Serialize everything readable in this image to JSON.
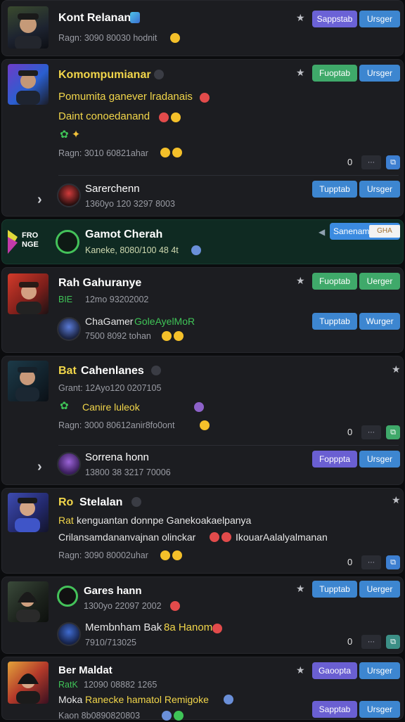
{
  "buttons": {
    "sapptab": "Sappstab",
    "ursger": "Ursger",
    "fuoptab": "Fuoptab",
    "tupptab": "Tupptab",
    "wurger": "Wurger",
    "fopppta": "Fopppta",
    "gaoopta": "Gaoopta",
    "ursger2": "Uerger",
    "sapptab2": "Sapptab"
  },
  "card1": {
    "name": "Kont Relanan",
    "meta": "Ragn: 3090 80030  hodnit"
  },
  "card2": {
    "name": "Komompumianar",
    "line1": "Pomumita ganever lradanais",
    "line2": "Daint conoedanand",
    "meta": "Ragn: 3010 60821ahar",
    "count": "0",
    "sub_name": "Sarerchenn",
    "sub_meta": "1360yo 120 3297 8003"
  },
  "card3": {
    "name": "Gamot Cherah",
    "meta": "Kaneke, 8080/100 48 4t",
    "logo_text": "FRO NGE",
    "badge": "Sanenam",
    "badge2": "GHA"
  },
  "card4": {
    "name": "Rah Gahuranye",
    "meta": "12mo 93202002",
    "meta_prefix": "BIE",
    "sub_name": "ChaGamer",
    "sub_name2": "GoleAyelMoR",
    "sub_meta": "7500 8092 tohan"
  },
  "card5": {
    "name": "Cahenlanes",
    "name_prefix": "Bat",
    "meta": "Grant: 12Ayo120 0207105",
    "line1": "Canire luleok",
    "line2": "Ragn: 3000 80612anir8fo0ont",
    "count": "0",
    "sub_name": "Sorrena honn",
    "sub_meta": "13800 38 3217 70006"
  },
  "card6": {
    "name": "Stelalan",
    "name_prefix": "Ro",
    "line_prefix": "Rat",
    "line1": "kenguantan donnpe Ganekoakaelpanya",
    "line2": "Crilansamdananvajnan olinckar",
    "line2b": "IkouarAalalyalmanan",
    "meta": "Ragn: 3090 80002uhar",
    "count": "0"
  },
  "card7": {
    "name": "Gares hann",
    "meta": "1300yo 22097 2002",
    "sub_name": "Membnham Bak",
    "sub_name_y": "8a Hanom",
    "sub_meta": "7910/713025",
    "count": "0"
  },
  "card8": {
    "name": "Ber Maldat",
    "meta_prefix": "RatK",
    "meta": "12090 08882 1265",
    "line_prefix": "Moka",
    "line1": "Ranecke hamatol Remigoke",
    "line2": "Kaon 8b0890820803"
  },
  "colors": {
    "purple": "#6b62d6",
    "blue": "#3d86d0",
    "green": "#3fa96a",
    "card": "#1c1d21",
    "highlight": "#0f2a22",
    "accent_yellow": "#f2d64a"
  }
}
